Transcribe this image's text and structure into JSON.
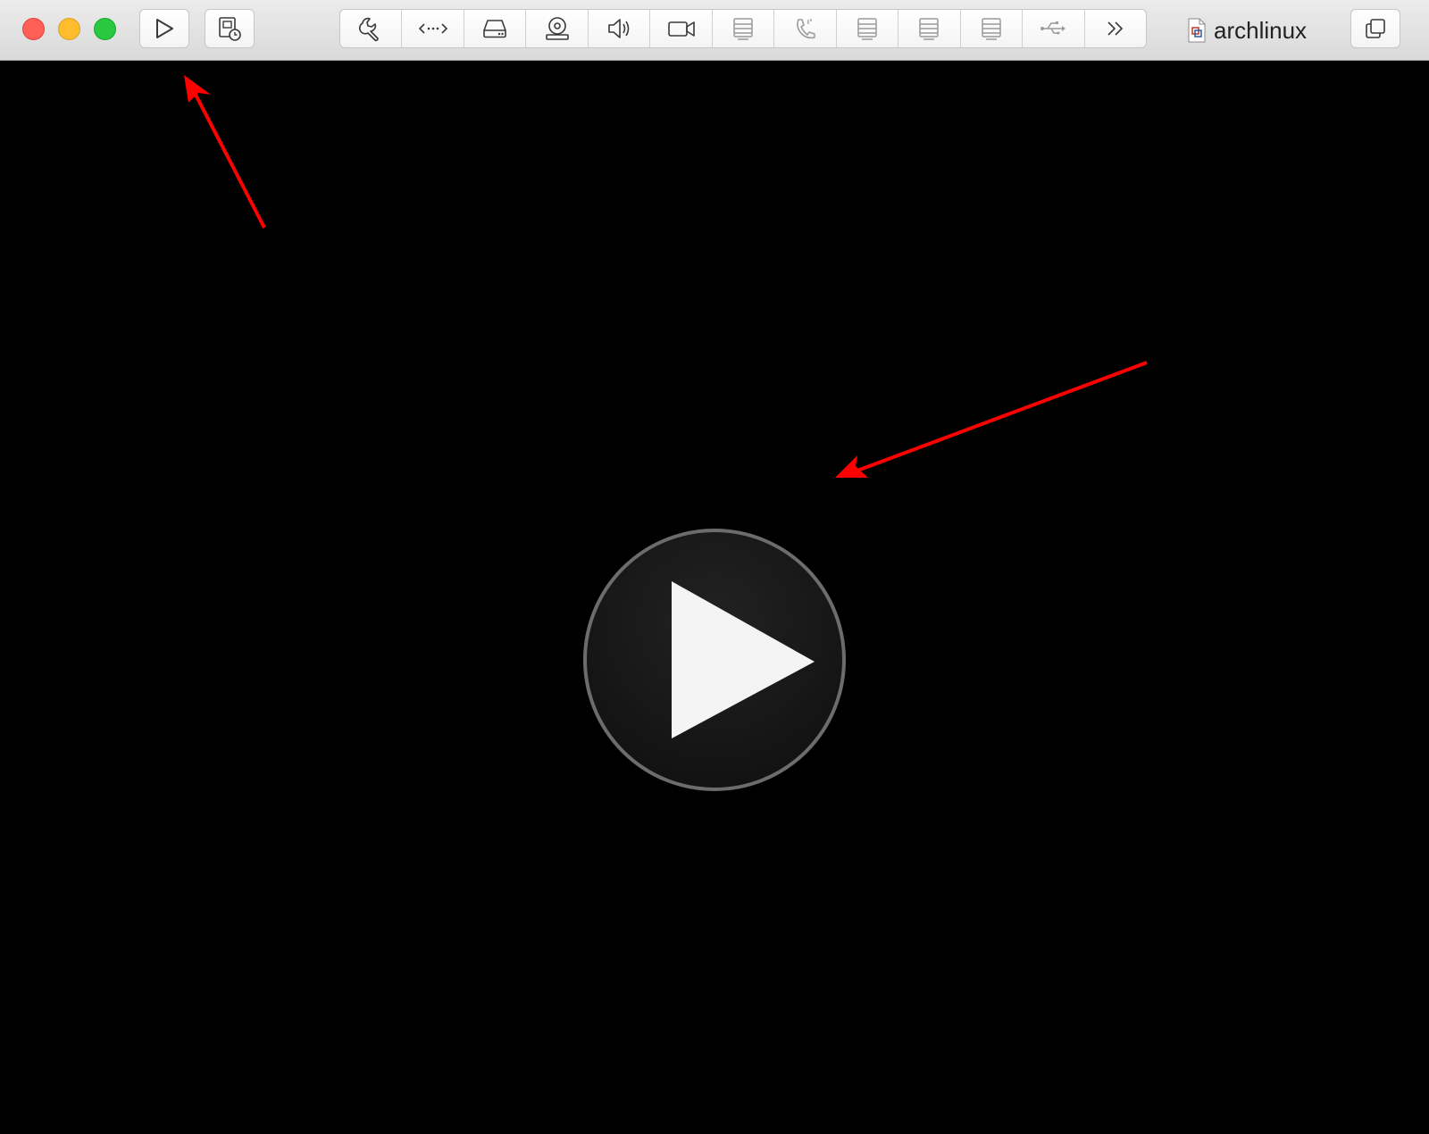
{
  "window": {
    "title": "archlinux",
    "traffic_lights": [
      "close",
      "minimize",
      "zoom"
    ]
  },
  "toolbar": {
    "left_buttons": [
      {
        "name": "play-icon"
      },
      {
        "name": "snapshot-icon"
      }
    ],
    "device_icons": [
      "wrench-icon",
      "network-icon",
      "hard-disk-icon",
      "cd-dvd-icon",
      "sound-icon",
      "camera-icon",
      "printer-icon",
      "modem-icon",
      "serial-port-icon",
      "parallel-port-icon",
      "storage-icon",
      "usb-icon",
      "more-chevron-icon"
    ],
    "right_button": "fullscreen-window-icon"
  },
  "viewport": {
    "state": "powered-off",
    "center_button": "play-icon"
  },
  "annotations": {
    "arrow_color": "#ff0000",
    "arrows": [
      "arrow-to-toolbar-play",
      "arrow-to-center-play"
    ]
  }
}
